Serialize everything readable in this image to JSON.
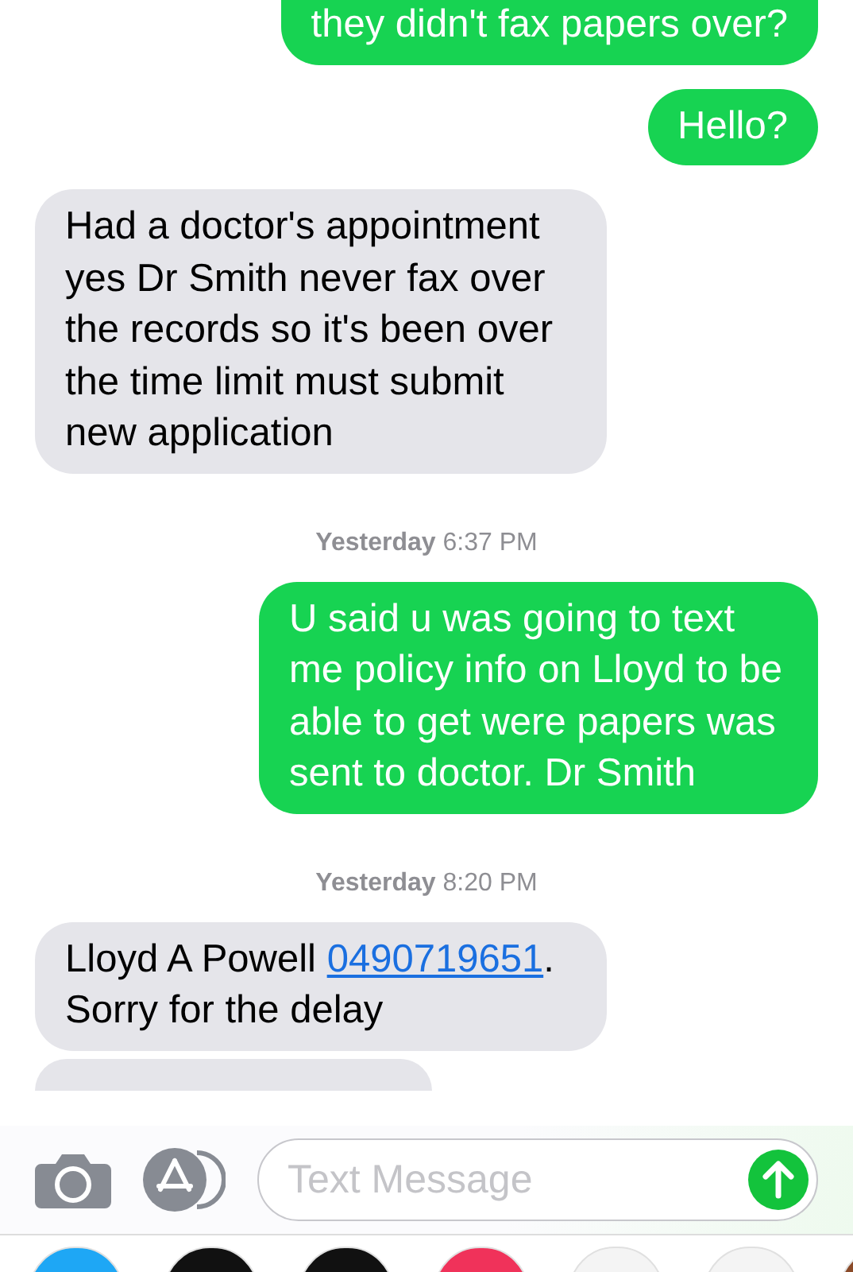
{
  "messages": [
    {
      "kind": "sent",
      "parts": [
        {
          "kind": "text",
          "text": "they didn't fax papers over?"
        }
      ]
    },
    {
      "kind": "sent",
      "parts": [
        {
          "kind": "text",
          "text": "Hello?"
        }
      ]
    },
    {
      "kind": "received",
      "parts": [
        {
          "kind": "text",
          "text": "Had a doctor's appointment yes Dr Smith never fax over the records so it's been over the time limit must submit new application"
        }
      ]
    },
    {
      "kind": "timestamp",
      "text": "**Yesterday** 6:37 PM"
    },
    {
      "kind": "sent",
      "parts": [
        {
          "kind": "text",
          "text": "U said u was going to text me policy info on Lloyd to be able to get were papers was sent to doctor. Dr Smith"
        }
      ]
    },
    {
      "kind": "timestamp",
      "text": "**Yesterday** 8:20 PM"
    },
    {
      "kind": "received",
      "parts": [
        {
          "kind": "text",
          "text": "Lloyd A Powell "
        },
        {
          "kind": "link",
          "text": "0490719651"
        },
        {
          "kind": "text",
          "text": ". Sorry for the delay"
        }
      ]
    }
  ],
  "composer": {
    "placeholder": "Text Message"
  }
}
